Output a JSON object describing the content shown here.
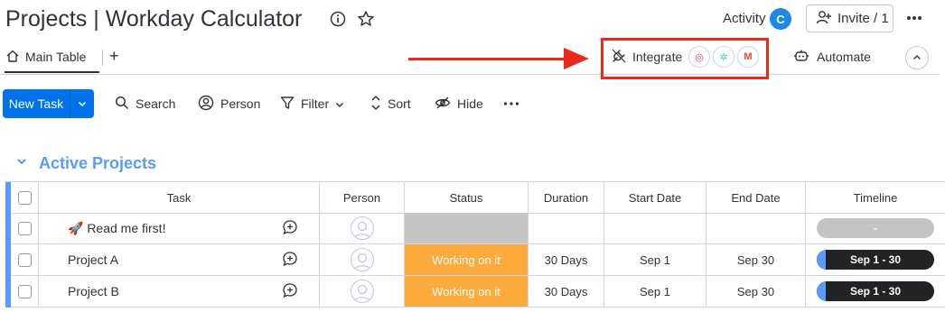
{
  "header": {
    "title": "Projects | Workday Calculator",
    "activity_label": "Activity",
    "activity_avatar": "C",
    "invite_label": "Invite / 1"
  },
  "tabs": {
    "main_table": "Main Table",
    "add": "+",
    "integrate": "Integrate",
    "integrate_badges": [
      "◎",
      "✲",
      "M"
    ],
    "automate": "Automate"
  },
  "toolbar": {
    "new_task": "New Task",
    "search": "Search",
    "person": "Person",
    "filter": "Filter",
    "sort": "Sort",
    "hide": "Hide"
  },
  "group": {
    "title": "Active Projects",
    "color": "#579bfc"
  },
  "columns": {
    "task": "Task",
    "person": "Person",
    "status": "Status",
    "duration": "Duration",
    "start_date": "Start Date",
    "end_date": "End Date",
    "timeline": "Timeline"
  },
  "rows": [
    {
      "task": "🚀 Read me first!",
      "status": "",
      "status_color": "#c4c4c4",
      "duration": "",
      "start_date": "",
      "end_date": "",
      "timeline": "-"
    },
    {
      "task": "Project A",
      "status": "Working on it",
      "status_color": "#fdab3d",
      "duration": "30 Days",
      "start_date": "Sep 1",
      "end_date": "Sep 30",
      "timeline": "Sep 1 - 30"
    },
    {
      "task": "Project B",
      "status": "Working on it",
      "status_color": "#fdab3d",
      "duration": "30 Days",
      "start_date": "Sep 1",
      "end_date": "Sep 30",
      "timeline": "Sep 1 - 30"
    }
  ],
  "colors": {
    "primary": "#0073ea",
    "annotation_red": "#e82a1c",
    "working_on_it": "#fdab3d"
  }
}
